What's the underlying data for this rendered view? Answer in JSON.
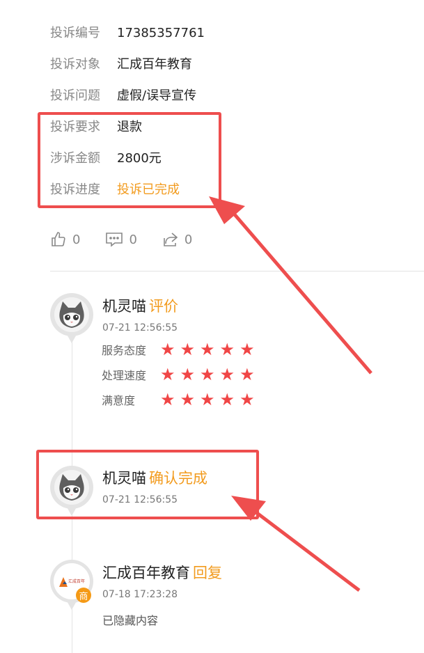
{
  "details": [
    {
      "label": "投诉编号",
      "value": "17385357761",
      "highlight": false
    },
    {
      "label": "投诉对象",
      "value": "汇成百年教育",
      "highlight": false
    },
    {
      "label": "投诉问题",
      "value": "虚假/误导宣传",
      "highlight": false
    },
    {
      "label": "投诉要求",
      "value": "退款",
      "highlight": false
    },
    {
      "label": "涉诉金额",
      "value": "2800元",
      "highlight": false
    },
    {
      "label": "投诉进度",
      "value": "投诉已完成",
      "highlight": true
    }
  ],
  "actions": {
    "like_count": "0",
    "comment_count": "0",
    "share_count": "0"
  },
  "timeline": [
    {
      "name": "机灵喵",
      "action": "评价",
      "time": "07-21 12:56:55",
      "ratings": [
        {
          "label": "服务态度",
          "stars": 5
        },
        {
          "label": "处理速度",
          "stars": 5
        },
        {
          "label": "满意度",
          "stars": 5
        }
      ]
    },
    {
      "name": "机灵喵",
      "action": "确认完成",
      "time": "07-21 12:56:55"
    },
    {
      "name": "汇成百年教育",
      "action": "回复",
      "time": "07-18 17:23:28",
      "badge": "商",
      "logo_text": "汇成百年",
      "content": "已隐藏内容"
    }
  ],
  "colors": {
    "accent_orange": "#f29b1e",
    "annotation_red": "#ee4e4e",
    "star_red": "#f04646"
  }
}
